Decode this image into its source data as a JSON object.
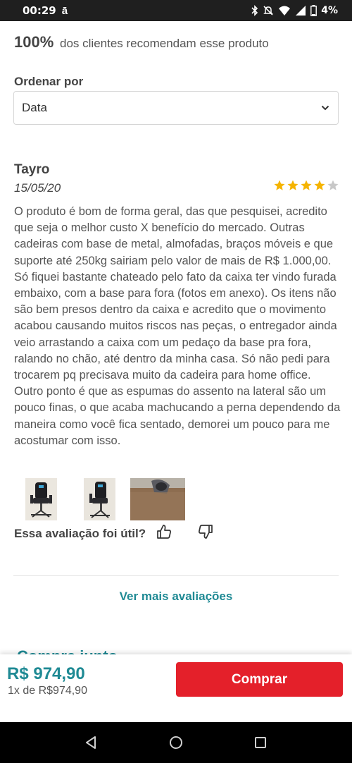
{
  "status_bar": {
    "time": "00:29",
    "left_indicator": "ā",
    "battery": "4%",
    "icons": [
      "bluetooth-icon",
      "mute-icon",
      "wifi-icon",
      "signal-icon",
      "battery-icon"
    ]
  },
  "summary": {
    "percent": "100%",
    "text": "dos clientes recomendam esse produto"
  },
  "sort": {
    "label": "Ordenar por",
    "selected": "Data"
  },
  "review": {
    "author": "Tayro",
    "date": "15/05/20",
    "rating": 4,
    "max_rating": 5,
    "text": "O produto é bom de forma geral, das que pesquisei, acredito que seja o melhor custo X benefício do mercado. Outras cadeiras com base de metal, almofadas, braços móveis e que suporte até 250kg sairiam pelo valor de mais de R$ 1.000,00. Só fiquei bastante chateado pelo fato da caixa ter vindo furada embaixo, com a base para fora (fotos em anexo). Os itens não são bem presos dentro da caixa e acredito que o movimento acabou causando muitos riscos nas peças, o entregador ainda veio arrastando a caixa com um pedaço da base pra fora, ralando no chão, até dentro da minha casa. Só não pedi para trocarem pq precisava muito da cadeira para home office. Outro ponto é que as espumas do assento na lateral são um pouco finas, o que acaba machucando a perna dependendo da maneira como você fica sentado, demorei um pouco para me acostumar com isso.",
    "photos": [
      "review-photo-chair-front",
      "review-photo-chair-side",
      "review-photo-box-damage"
    ],
    "helpful_question": "Essa avaliação foi útil?"
  },
  "more_reviews_link": "Ver mais avaliações",
  "partial_heading": "Compre junto",
  "buy_bar": {
    "price": "R$ 974,90",
    "installment": "1x de R$974,90",
    "button_label": "Comprar"
  },
  "colors": {
    "accent": "#1f8a94",
    "buy_button": "#e4202a",
    "star_filled": "#f5b400",
    "star_empty": "#c8c8c8"
  }
}
